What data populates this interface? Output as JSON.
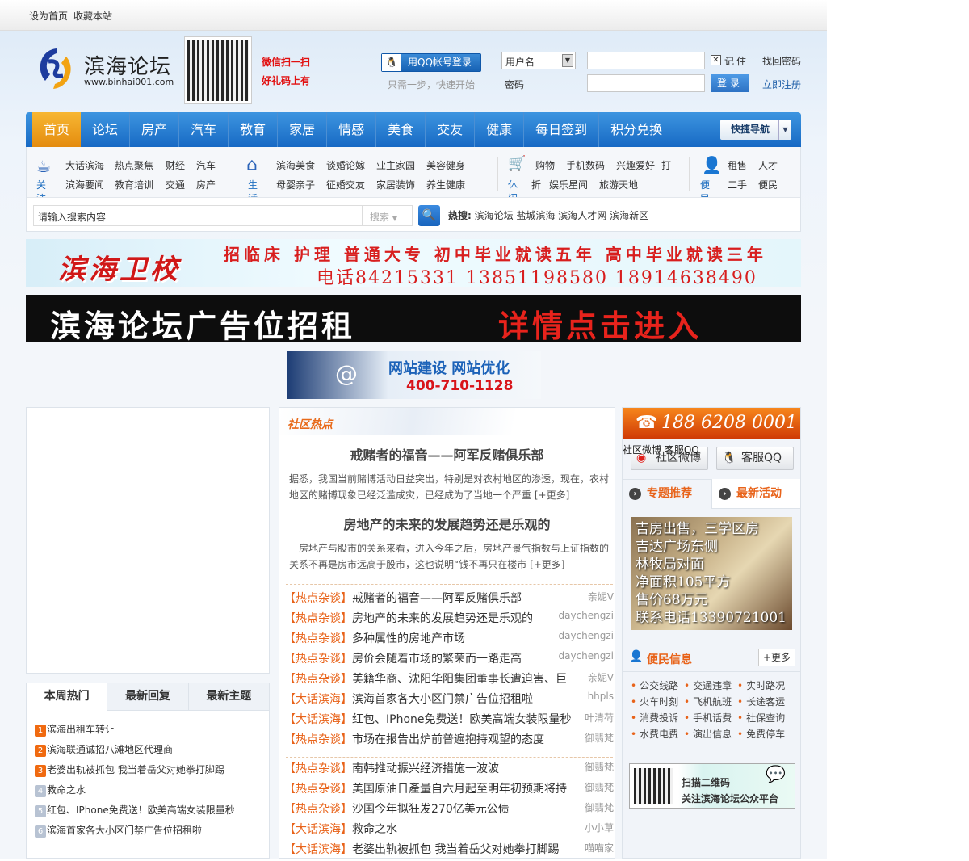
{
  "topbar": {
    "set_home": "设为首页",
    "bookmark": "收藏本站"
  },
  "header": {
    "logo_title": "滨海论坛",
    "logo_url": "www.binhai001.com",
    "wechat_line1": "微信扫一扫",
    "wechat_line2": "好礼码上有",
    "qq_login": "用QQ帐号登录",
    "qq_hint": "只需一步，快速开始",
    "username_select": "用户名",
    "password_label": "密码",
    "remember": "记住",
    "forgot": "找回密码",
    "login": "登录",
    "register": "立即注册"
  },
  "nav": {
    "items": [
      "首页",
      "论坛",
      "房产",
      "汽车",
      "教育",
      "家居",
      "情感",
      "美食",
      "交友",
      "健康",
      "每日签到",
      "积分兑换"
    ],
    "quick": "快捷导航"
  },
  "subnav": {
    "groups": [
      {
        "cap": "关注",
        "links": [
          "大话滨海",
          "热点聚焦",
          "财经",
          "汽车",
          "滨海要闻",
          "教育培训",
          "交通",
          "房产"
        ]
      },
      {
        "cap": "生活",
        "links": [
          "滨海美食",
          "谈婚论嫁",
          "业主家园",
          "美容健身",
          "母婴亲子",
          "征婚交友",
          "家居装饰",
          "养生健康"
        ]
      },
      {
        "cap": "休闲",
        "links": [
          "购物",
          "手机数码",
          "兴趣爱好",
          "打",
          "折",
          "娱乐星闻",
          "旅游天地"
        ]
      },
      {
        "cap": "便民",
        "links": [
          "租售",
          "人才",
          "二手",
          "便民"
        ]
      }
    ],
    "search_placeholder": "请输入搜索内容",
    "search_type": "搜索",
    "hot_label": "热搜:",
    "hot_terms": "滨海论坛 盐城滨海 滨海人才网 滨海新区"
  },
  "ads": {
    "ad1_logo": "滨海卫校",
    "ad1_line1": "招临床 护理 普通大专 初中毕业就读五年 高中毕业就读三年",
    "ad1_line2": "电话84215331 13851198580 18914638490",
    "ad2_a": "滨海论坛广告位招租",
    "ad2_b": "详情点击进入",
    "ad3_a": "网站建设 网站优化",
    "ad3_b": "400-710-1128"
  },
  "left_tabs": {
    "tabs": [
      "本周热门",
      "最新回复",
      "最新主题"
    ],
    "items": [
      "滨海出租车转让",
      "滨海联通诚招八滩地区代理商",
      "老婆出轨被抓包 我当着岳父对她拳打脚踢",
      "救命之水",
      "红包、IPhone免费送！欧美高端女装限量秒",
      "滨海首家各大小区门禁广告位招租啦"
    ]
  },
  "middle": {
    "title": "社区热点",
    "features": [
      {
        "title": "戒赌者的福音——阿军反赌俱乐部",
        "text": "据悉，我国当前赌博活动日益突出，特别是对农村地区的渗透，现在，农村地区的赌博现象已经泛滥成灾，已经成为了当地一个严重",
        "more": "[+更多]"
      },
      {
        "title": "房地产的未来的发展趋势还是乐观的",
        "text": "　房地产与股市的关系来看，进入今年之后，房地产景气指数与上证指数的关系不再是房市远高于股市，这也说明“钱不再只在楼市",
        "more": "[+更多]"
      }
    ],
    "list1": [
      {
        "tag": "【热点杂谈】",
        "title": "戒赌者的福音——阿军反赌俱乐部",
        "user": "亲妮V"
      },
      {
        "tag": "【热点杂谈】",
        "title": "房地产的未来的发展趋势还是乐观的",
        "user": "daychengzi"
      },
      {
        "tag": "【热点杂谈】",
        "title": "多种属性的房地产市场",
        "user": "daychengzi"
      },
      {
        "tag": "【热点杂谈】",
        "title": "房价会随着市场的繁荣而一路走高",
        "user": "daychengzi"
      },
      {
        "tag": "【热点杂谈】",
        "title": "美籍华商、沈阳华阳集团董事长遭迫害、巨",
        "user": "亲妮V"
      },
      {
        "tag": "【大话滨海】",
        "title": "滨海首家各大小区门禁广告位招租啦",
        "user": "hhpls"
      },
      {
        "tag": "【大话滨海】",
        "title": "红包、IPhone免费送！欧美高端女装限量秒",
        "user": "叶清荷"
      },
      {
        "tag": "【热点杂谈】",
        "title": "市场在报告出炉前普遍抱持观望的态度",
        "user": "御翡梵"
      }
    ],
    "list2": [
      {
        "tag": "【热点杂谈】",
        "title": "南韩推动振兴经济措施一波波",
        "user": "御翡梵"
      },
      {
        "tag": "【热点杂谈】",
        "title": "美国原油日產量自六月起至明年初预期将持",
        "user": "御翡梵"
      },
      {
        "tag": "【热点杂谈】",
        "title": "沙国今年拟狂发270亿美元公债",
        "user": "御翡梵"
      },
      {
        "tag": "【大话滨海】",
        "title": "救命之水",
        "user": "小小草"
      },
      {
        "tag": "【大话滨海】",
        "title": "老婆出轨被抓包 我当着岳父对她拳打脚踢",
        "user": "喵喵家"
      }
    ]
  },
  "right": {
    "phone": "188 6208 0001",
    "alt_text": "社区微博 客服QQ",
    "weibo": "社区微博",
    "qq": "客服QQ",
    "tab1": "专题推荐",
    "tab2": "最新活动",
    "house_lines": [
      "吉房出售，三学区房",
      "吉达广场东侧",
      "林牧局对面",
      "净面积105平方",
      "售价68万元",
      "联系电话13390721001"
    ],
    "bianmin_title": "便民信息",
    "more": "+更多",
    "bianmin": [
      "公交线路",
      "交通违章",
      "实时路况",
      "火车时刻",
      "飞机航班",
      "长途客运",
      "消费投诉",
      "手机话费",
      "社保查询",
      "水费电费",
      "演出信息",
      "免费停车"
    ],
    "wx_line1": "扫描二维码",
    "wx_line2": "关注滨海论坛公众平台"
  },
  "colors": {
    "nav_blue": "#1769c4",
    "accent_orange": "#e8631a",
    "active_tab": "#f0a020"
  }
}
